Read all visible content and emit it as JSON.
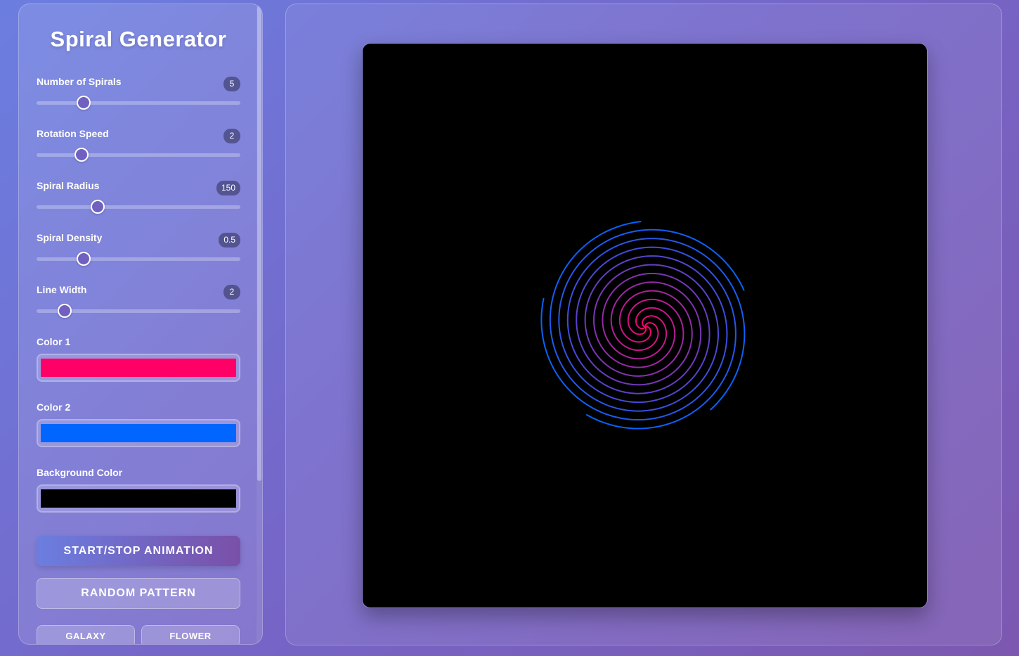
{
  "app": {
    "title": "Spiral Generator"
  },
  "controls": [
    {
      "id": "spirals",
      "label": "Number of Spirals",
      "value": "5",
      "min": 1,
      "max": 20,
      "current": 5
    },
    {
      "id": "speed",
      "label": "Rotation Speed",
      "value": "2",
      "min": 0,
      "max": 10,
      "current": 2
    },
    {
      "id": "radius",
      "label": "Spiral Radius",
      "value": "150",
      "min": 50,
      "max": 400,
      "current": 150
    },
    {
      "id": "density",
      "label": "Spiral Density",
      "value": "0.5",
      "min": 0.1,
      "max": 2,
      "current": 0.5
    },
    {
      "id": "linewidth",
      "label": "Line Width",
      "value": "2",
      "min": 1,
      "max": 10,
      "current": 2
    }
  ],
  "colors": {
    "color1": {
      "label": "Color 1",
      "value": "#ff0066"
    },
    "color2": {
      "label": "Color 2",
      "value": "#0066ff"
    },
    "background": {
      "label": "Background Color",
      "value": "#000000"
    }
  },
  "buttons": {
    "start_stop": "START/STOP ANIMATION",
    "random": "RANDOM PATTERN",
    "galaxy": "GALAXY",
    "flower": "FLOWER"
  }
}
